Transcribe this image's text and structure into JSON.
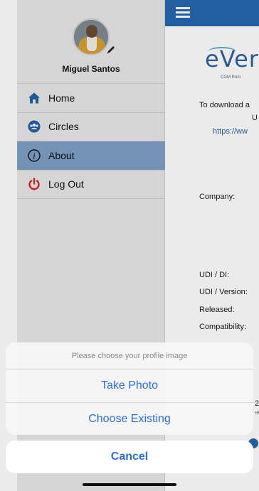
{
  "about_page": {
    "brand_word": "eVer",
    "brand_tagline": "CGM Rem",
    "download_text": "To download a",
    "download_text_2": "U",
    "download_link": "https://ww",
    "company_label": "Company:",
    "udi_di_label": "UDI / DI:",
    "udi_version_label": "UDI / Version:",
    "released_label": "Released:",
    "compatibility_label": "Compatibility:",
    "fragment_1": "2(",
    "fragment_2": "re"
  },
  "side_menu": {
    "profile_name": "Miguel Santos",
    "items": [
      {
        "label": "Home",
        "icon": "home-icon",
        "active": false
      },
      {
        "label": "Circles",
        "icon": "circles-icon",
        "active": false
      },
      {
        "label": "About",
        "icon": "info-icon",
        "active": true
      },
      {
        "label": "Log Out",
        "icon": "power-icon",
        "active": false
      }
    ]
  },
  "action_sheet": {
    "title": "Please choose your profile image",
    "options": [
      "Take Photo",
      "Choose Existing"
    ],
    "cancel_label": "Cancel"
  },
  "colors": {
    "top_bar": "#2566b0",
    "active_item": "#7e9fc6",
    "action_blue": "#2870d8",
    "logout_red": "#d6291e"
  }
}
